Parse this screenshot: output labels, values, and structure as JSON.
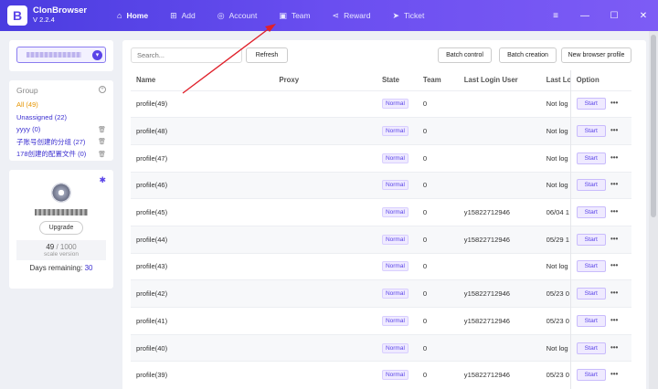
{
  "app": {
    "name": "ClonBrowser",
    "version": "V 2.2.4",
    "logo_letter": "B"
  },
  "nav": [
    {
      "label": "Home",
      "icon": "home-icon",
      "glyph": "⌂",
      "active": true
    },
    {
      "label": "Add",
      "icon": "add-icon",
      "glyph": "⊞"
    },
    {
      "label": "Account",
      "icon": "account-icon",
      "glyph": "◎"
    },
    {
      "label": "Team",
      "icon": "team-icon",
      "glyph": "▣"
    },
    {
      "label": "Reward",
      "icon": "share-icon",
      "glyph": "⋖"
    },
    {
      "label": "Ticket",
      "icon": "send-icon",
      "glyph": "➤"
    }
  ],
  "window_controls": {
    "menu": "≡",
    "minimize": "—",
    "maximize": "☐",
    "close": "✕"
  },
  "groups": {
    "title": "Group",
    "items": [
      {
        "label": "All  (49)",
        "active": true
      },
      {
        "label": "Unassigned  (22)"
      },
      {
        "label": "yyyy  (0)",
        "trash": true
      },
      {
        "label": "子账号创建的分组  (27)",
        "trash": true
      },
      {
        "label": "178创建的配置文件  (0)",
        "trash": true
      }
    ]
  },
  "account": {
    "upgrade_label": "Upgrade",
    "usage_used": "49",
    "usage_sep": " / ",
    "usage_total": "1000",
    "plan": "scale version",
    "days_label": "Days remaining:",
    "days_value": "30"
  },
  "toolbar": {
    "search_placeholder": "Search...",
    "refresh": "Refresh",
    "batch_control": "Batch control",
    "batch_creation": "Batch creation",
    "new_profile": "New browser profile"
  },
  "table": {
    "headers": [
      "Name",
      "Proxy",
      "State",
      "Team",
      "Last Login User",
      "Last Login",
      "Option"
    ],
    "start_label": "Start",
    "more_label": "•••",
    "rows": [
      {
        "name": "profile(49)",
        "state": "Normal",
        "team": "0",
        "user": "",
        "last": "Not log"
      },
      {
        "name": "profile(48)",
        "state": "Normal",
        "team": "0",
        "user": "",
        "last": "Not log"
      },
      {
        "name": "profile(47)",
        "state": "Normal",
        "team": "0",
        "user": "",
        "last": "Not log"
      },
      {
        "name": "profile(46)",
        "state": "Normal",
        "team": "0",
        "user": "",
        "last": "Not log"
      },
      {
        "name": "profile(45)",
        "state": "Normal",
        "team": "0",
        "user": "y15822712946",
        "last": "06/04 1"
      },
      {
        "name": "profile(44)",
        "state": "Normal",
        "team": "0",
        "user": "y15822712946",
        "last": "05/29 1"
      },
      {
        "name": "profile(43)",
        "state": "Normal",
        "team": "0",
        "user": "",
        "last": "Not log"
      },
      {
        "name": "profile(42)",
        "state": "Normal",
        "team": "0",
        "user": "y15822712946",
        "last": "05/23 0"
      },
      {
        "name": "profile(41)",
        "state": "Normal",
        "team": "0",
        "user": "y15822712946",
        "last": "05/23 0"
      },
      {
        "name": "profile(40)",
        "state": "Normal",
        "team": "0",
        "user": "",
        "last": "Not log"
      },
      {
        "name": "profile(39)",
        "state": "Normal",
        "team": "0",
        "user": "y15822712946",
        "last": "05/23 0"
      }
    ]
  },
  "colors": {
    "accent": "#5a44e8",
    "arrow": "#e0212b",
    "group_active": "#e69500"
  }
}
